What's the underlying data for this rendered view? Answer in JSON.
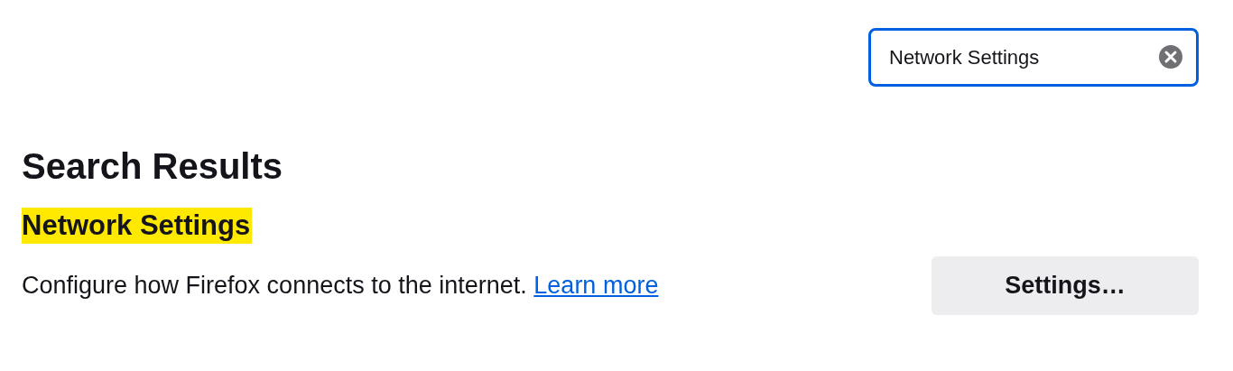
{
  "search": {
    "value": "Network Settings",
    "focused": true
  },
  "heading": "Search Results",
  "result": {
    "title": "Network Settings",
    "highlighted": true,
    "description": "Configure how Firefox connects to the internet.",
    "link": "Learn more",
    "button": "Settings…"
  }
}
